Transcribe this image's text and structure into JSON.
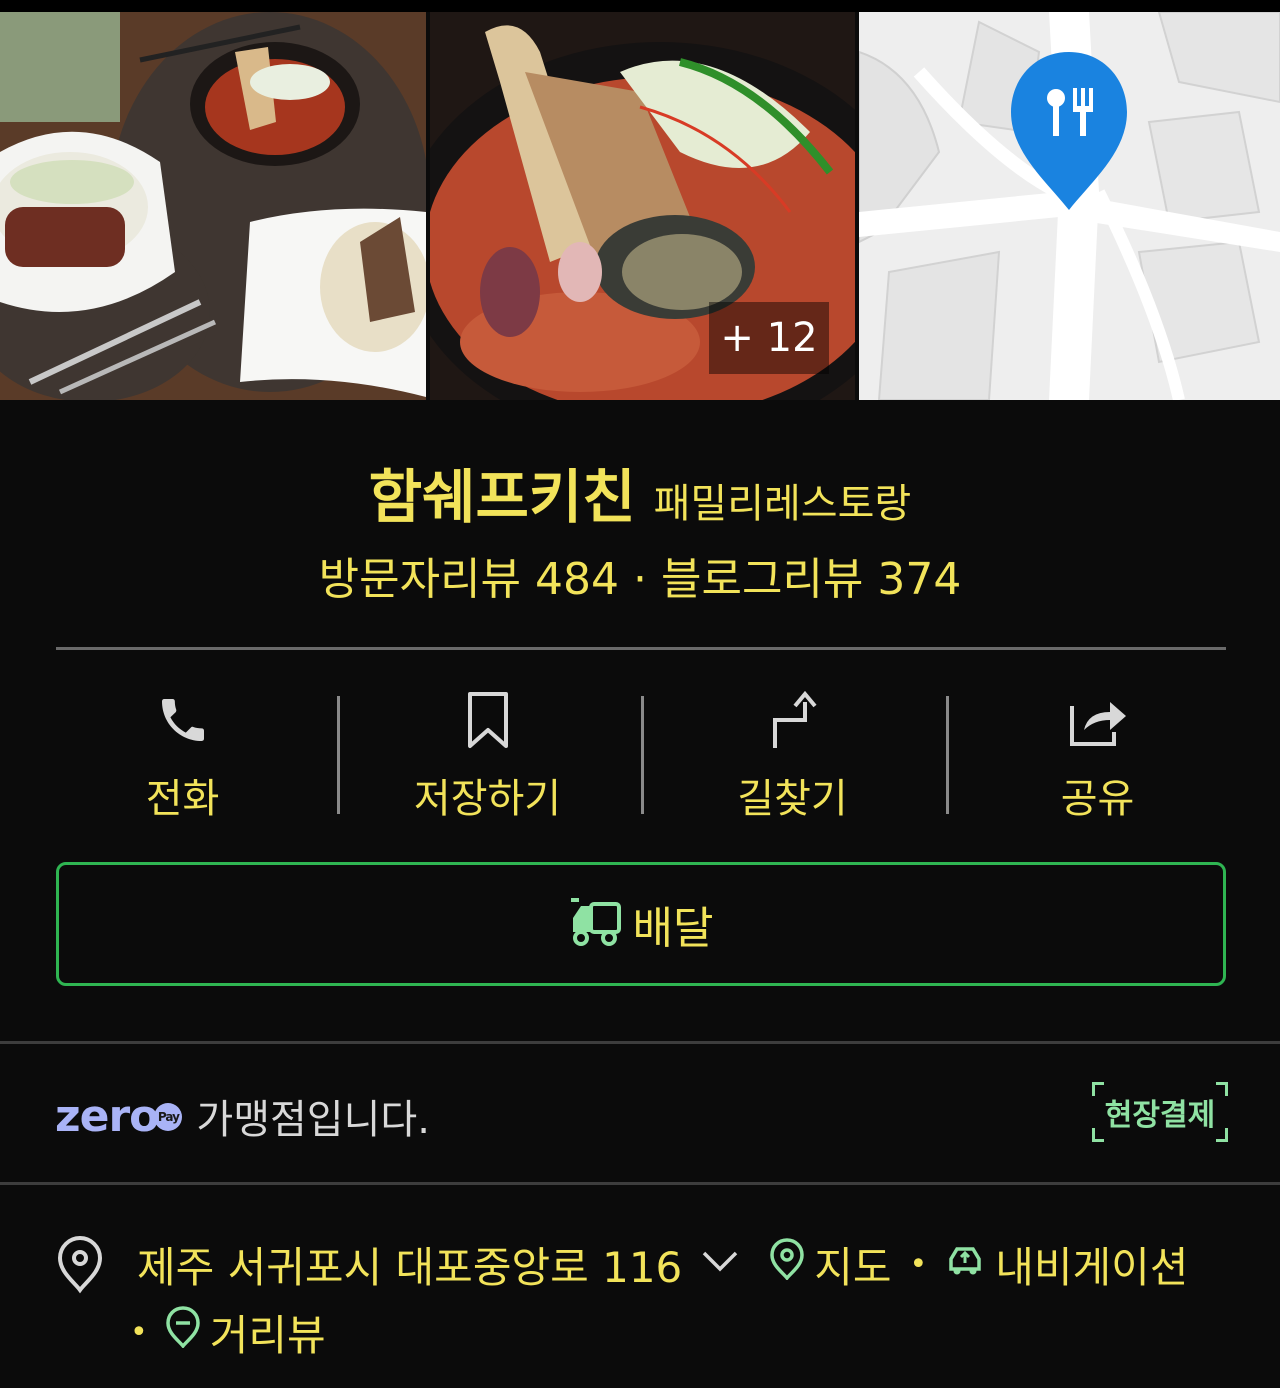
{
  "photos": {
    "more_count": "+ 12",
    "map_pin_icon": "restaurant-pin-icon"
  },
  "place": {
    "name": "함쉐프키친",
    "category": "패밀리레스토랑",
    "visitor_reviews_label": "방문자리뷰 484",
    "separator": "·",
    "blog_reviews_label": "블로그리뷰 374"
  },
  "actions": [
    {
      "label": "전화",
      "icon": "phone-icon"
    },
    {
      "label": "저장하기",
      "icon": "bookmark-icon"
    },
    {
      "label": "길찾기",
      "icon": "directions-icon"
    },
    {
      "label": "공유",
      "icon": "share-icon"
    }
  ],
  "delivery": {
    "label": "배달",
    "icon": "delivery-truck-icon"
  },
  "zeropay": {
    "logo_text": "zero",
    "logo_badge": "Pay",
    "text": "가맹점입니다.",
    "badge": "현장결제"
  },
  "address": {
    "text": "제주 서귀포시 대포중앙로 116",
    "map_link": "지도",
    "navigation_link": "내비게이션",
    "street_view_link": "거리뷰",
    "separator": "•"
  },
  "colors": {
    "text_primary": "#f2e35a",
    "accent_green": "#2fb552",
    "link_green": "#8fe2a3",
    "zero_blue": "#a9b3f6",
    "background": "#0b0b0b"
  }
}
